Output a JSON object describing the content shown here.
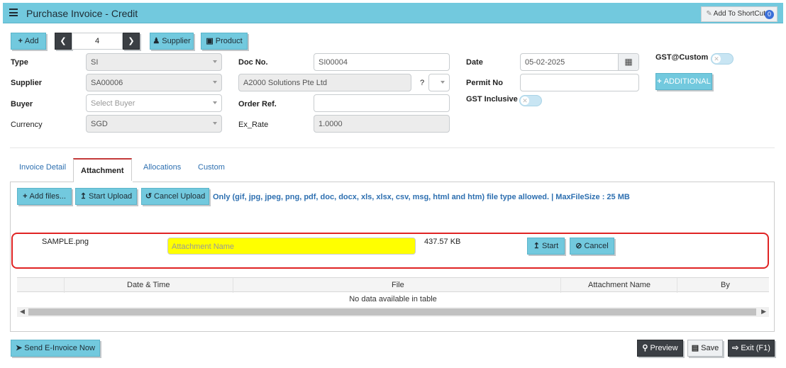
{
  "header": {
    "title": "Purchase Invoice - Credit",
    "shortcut_label": "Add To ShortCut",
    "shortcut_count": "0"
  },
  "toolbar": {
    "add": "Add",
    "record_no": "4",
    "supplier": "Supplier",
    "product": "Product"
  },
  "form": {
    "type_label": "Type",
    "type_value": "SI",
    "supplier_label": "Supplier",
    "supplier_value": "SA00006",
    "buyer_label": "Buyer",
    "buyer_placeholder": "Select Buyer",
    "currency_label": "Currency",
    "currency_value": "SGD",
    "docno_label": "Doc No.",
    "docno_value": "SI00004",
    "supplier_name": "A2000 Solutions Pte Ltd",
    "question": "?",
    "orderref_label": "Order Ref.",
    "orderref_value": "",
    "exrate_label": "Ex_Rate",
    "exrate_value": "1.0000",
    "date_label": "Date",
    "date_value": "05-02-2025",
    "permit_label": "Permit No",
    "permit_value": "",
    "gstinclusive_label": "GST Inclusive",
    "gstcustom_label": "GST@Custom",
    "additional_label": "ADDITIONAL"
  },
  "tabs": [
    "Invoice Detail",
    "Attachment",
    "Allocations",
    "Custom"
  ],
  "attachment": {
    "add_files": "Add files...",
    "start_upload": "Start Upload",
    "cancel_upload": "Cancel Upload",
    "allowed_text": "Only (gif, jpg, jpeg, png, pdf, doc, docx, xls, xlsx, csv, msg, html and htm) file type allowed. | MaxFileSize : 25 MB",
    "file_name": "SAMPLE.png",
    "name_placeholder": "Attachment Name",
    "file_size": "437.57 KB",
    "start": "Start",
    "cancel": "Cancel"
  },
  "table": {
    "columns": [
      "Date & Time",
      "File",
      "Attachment Name",
      "By"
    ],
    "empty_text": "No data available in table"
  },
  "footer": {
    "send": "Send E-Invoice Now",
    "preview": "Preview",
    "save": "Save",
    "exit": "Exit (F1)"
  }
}
